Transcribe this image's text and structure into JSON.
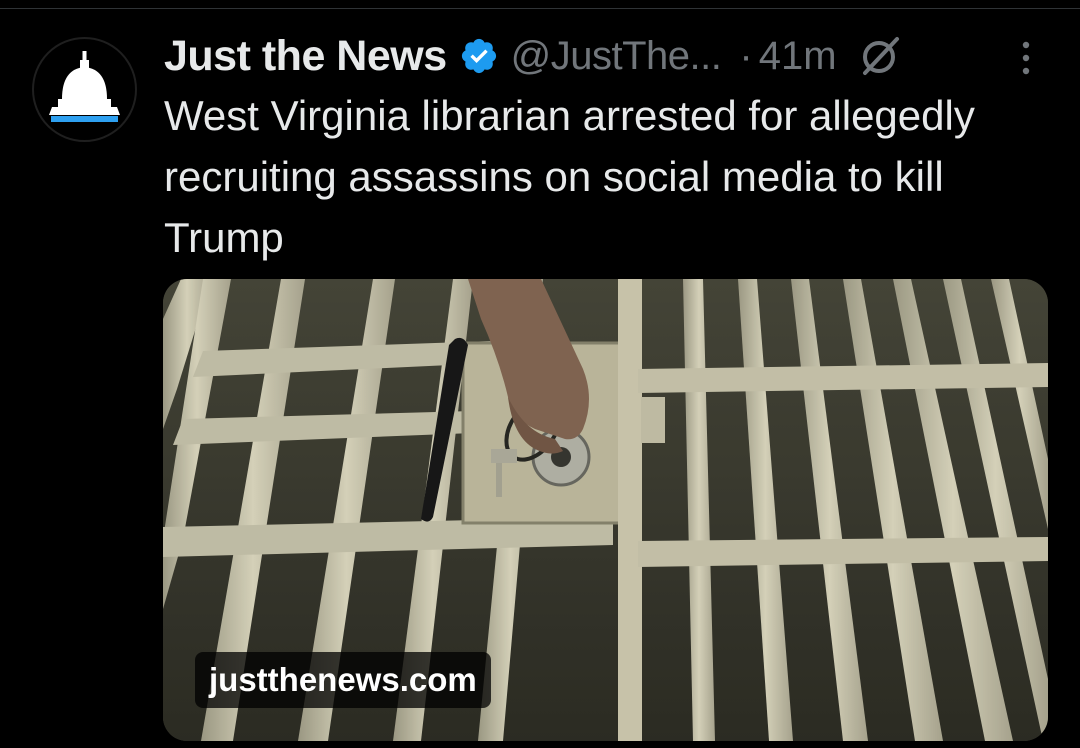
{
  "tweet": {
    "author_name": "Just the News",
    "verified": true,
    "handle": "@JustThe...",
    "separator": "·",
    "time": "41m",
    "text": "West Virginia librarian arrested for allegedly recruiting assassins on social media to kill Trump",
    "media": {
      "domain": "justthenews.com"
    }
  },
  "icons": {
    "avatar": "capitol-dome-icon",
    "verified": "verified-badge-icon",
    "grok": "grok-icon",
    "more": "more-vertical-icon"
  },
  "colors": {
    "background": "#000000",
    "text_primary": "#e7e9ea",
    "text_secondary": "#71767b",
    "verified_blue": "#1d9bf0",
    "avatar_stripe": "#2ea0f0"
  }
}
